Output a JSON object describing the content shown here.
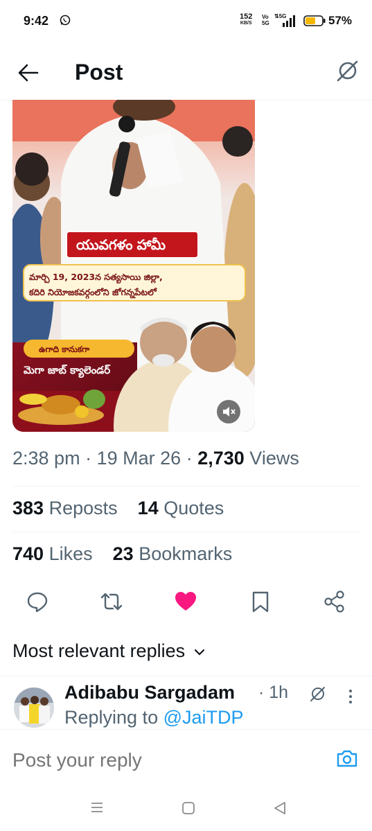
{
  "status_bar": {
    "time": "9:42",
    "net_speed": "152",
    "net_unit": "KB/S",
    "vo_top": "Vo",
    "vo_bottom": "5G",
    "battery": "57%"
  },
  "header": {
    "title": "Post"
  },
  "media": {
    "banner_title_1": "యువగళం",
    "banner_title_2": "హామీ",
    "subtitle_line1": "మార్చి 19, 2023న సత్యసాయి జిల్లా,",
    "subtitle_line2": "కదిరి నియోజకవర్గంలోని జోగన్నపేటలో",
    "ugadi": "ఉగాది కానుకగా",
    "mega": "మెగా జాబ్ క్యాలెండర్"
  },
  "meta": {
    "time": "2:38 pm",
    "date": "19 Mar 26",
    "views_count": "2,730",
    "views_label": "Views",
    "sep": "·"
  },
  "stats": {
    "reposts_count": "383",
    "reposts_label": "Reposts",
    "quotes_count": "14",
    "quotes_label": "Quotes",
    "likes_count": "740",
    "likes_label": "Likes",
    "bookmarks_count": "23",
    "bookmarks_label": "Bookmarks"
  },
  "replies": {
    "header": "Most relevant replies",
    "items": [
      {
        "name": "Adibabu Sargadam",
        "time": "· 1h",
        "replying_prefix": "Replying to",
        "replying_handle": "@JaiTDP"
      }
    ]
  },
  "composer": {
    "placeholder": "Post your reply"
  },
  "colors": {
    "accent": "#1d9bf0",
    "like": "#f91880",
    "muted": "#536471",
    "text": "#0f1419"
  }
}
